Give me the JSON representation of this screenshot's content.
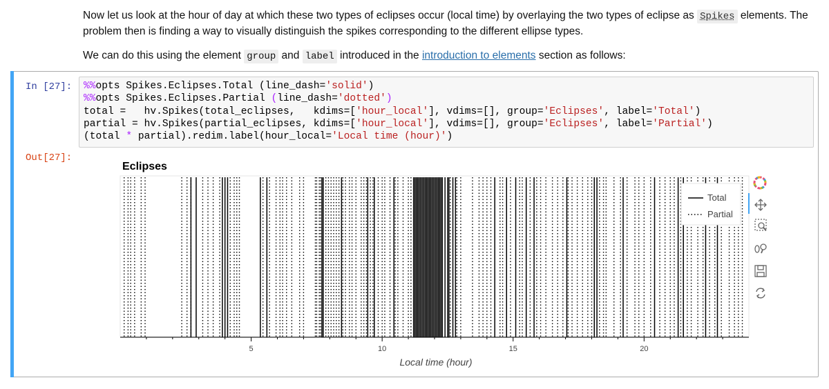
{
  "markdown": {
    "p1_part1": "Now let us look at the hour of day at which these two types of eclipses occur (local time) by overlaying the two types of eclipse as ",
    "p1_code": "Spikes",
    "p1_part2": " elements. The problem then is finding a way to visually distinguish the spikes corresponding to the different ellipse types.",
    "p2_part1": "We can do this using the element ",
    "p2_code1": "group",
    "p2_part2": " and ",
    "p2_code2": "label",
    "p2_part3": " introduced in the ",
    "p2_link": "introduction to elements",
    "p2_part4": " section as follows:"
  },
  "cell": {
    "in_prompt": "In [27]:",
    "out_prompt": "Out[27]:",
    "code": {
      "l1_magic": "%%",
      "l1_rest": "opts Spikes.Eclipses.Total (line_dash=",
      "l1_str": "'solid'",
      "l1_end": ")",
      "l2_magic": "%%",
      "l2_rest": "opts Spikes.Eclipses.Partial ",
      "l2_paren": "(",
      "l2_mid": "line_dash=",
      "l2_str": "'dotted'",
      "l2_end": ")",
      "l3_a": "total =   hv.Spikes(total_eclipses,   kdims=[",
      "l3_s1": "'hour_local'",
      "l3_b": "], vdims=[], group=",
      "l3_s2": "'Eclipses'",
      "l3_c": ", label=",
      "l3_s3": "'Total'",
      "l3_d": ")",
      "l4_a": "partial = hv.Spikes(partial_eclipses, kdims=[",
      "l4_s1": "'hour_local'",
      "l4_b": "], vdims=[], group=",
      "l4_s2": "'Eclipses'",
      "l4_c": ", label=",
      "l4_s3": "'Partial'",
      "l4_d": ")",
      "l5_a": "(total ",
      "l5_op": "*",
      "l5_b": " partial).redim.label(hour_local=",
      "l5_s": "'Local time (hour)'",
      "l5_c": ")"
    }
  },
  "toolbar": {
    "icons": [
      "bokeh-logo-icon",
      "pan-icon",
      "box-zoom-icon",
      "wheel-zoom-icon",
      "save-icon",
      "reset-icon"
    ]
  },
  "chart_data": {
    "type": "spikes",
    "title": "Eclipses",
    "xlabel": "Local time (hour)",
    "xlim": [
      0,
      24
    ],
    "xticks": [
      5,
      10,
      15,
      20
    ],
    "legend_position": "top-right",
    "series": [
      {
        "name": "Total",
        "line_dash": "solid",
        "color": "#000000",
        "x": [
          2.7,
          2.9,
          3.9,
          4.0,
          4.1,
          5.35,
          5.6,
          7.7,
          7.75,
          8.45,
          9.45,
          9.7,
          10.45,
          11.2,
          11.25,
          11.3,
          11.35,
          11.4,
          11.45,
          11.5,
          11.55,
          11.6,
          11.65,
          11.7,
          11.75,
          11.8,
          11.85,
          11.9,
          11.95,
          12.0,
          12.05,
          12.1,
          12.15,
          12.2,
          12.25,
          12.3,
          12.4,
          12.5,
          12.55,
          12.7,
          12.8,
          14.3,
          14.75,
          15.1,
          15.5,
          15.8,
          17.05,
          18.1,
          18.2,
          19.2,
          20.4,
          21.3,
          21.5,
          22.35,
          22.8
        ]
      },
      {
        "name": "Partial",
        "line_dash": "dotted",
        "color": "#000000",
        "x": [
          0.15,
          0.3,
          0.4,
          0.55,
          0.8,
          0.95,
          2.35,
          2.55,
          2.7,
          3.15,
          3.35,
          3.55,
          3.8,
          4.2,
          4.35,
          4.45,
          4.55,
          5.45,
          5.7,
          5.95,
          6.1,
          6.2,
          6.35,
          6.55,
          6.85,
          7.0,
          7.45,
          7.5,
          7.6,
          7.65,
          7.85,
          7.95,
          8.05,
          8.15,
          8.25,
          8.35,
          8.5,
          8.6,
          8.75,
          8.85,
          9.0,
          9.2,
          9.3,
          9.4,
          9.55,
          9.65,
          9.85,
          10.0,
          10.1,
          10.3,
          10.5,
          10.6,
          10.8,
          11.0,
          11.1,
          12.6,
          12.85,
          13.0,
          13.45,
          13.7,
          13.85,
          14.0,
          14.15,
          14.5,
          14.6,
          14.9,
          15.25,
          15.35,
          15.65,
          15.9,
          16.05,
          16.25,
          16.5,
          16.7,
          16.9,
          17.1,
          17.25,
          17.45,
          17.65,
          17.85,
          18.0,
          18.3,
          18.45,
          18.55,
          18.85,
          19.1,
          19.35,
          19.65,
          19.8,
          20.0,
          20.25,
          20.6,
          20.8,
          21.0,
          21.15,
          21.4,
          21.65,
          21.8,
          22.05,
          22.25,
          22.5,
          22.7,
          22.95,
          23.25,
          23.45,
          23.6,
          23.75
        ]
      }
    ],
    "colors": {
      "prompt_in": "#303f9f",
      "prompt_out": "#d84315",
      "cell_bar": "#42a5f5",
      "link": "#296eaa"
    }
  }
}
